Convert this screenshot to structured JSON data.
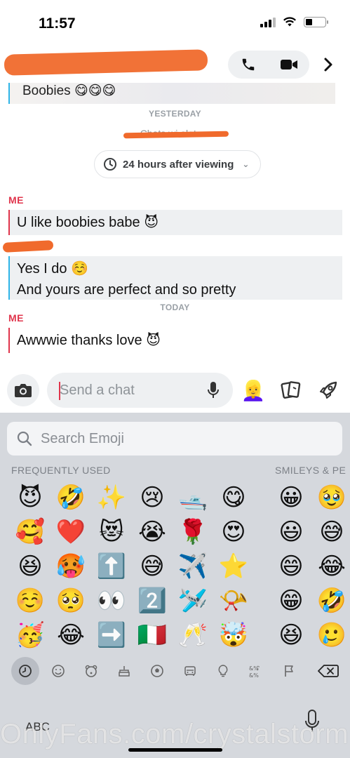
{
  "status_bar": {
    "time": "11:57",
    "battery_level": 0.35
  },
  "header": {
    "contact_name": "",
    "call_icon": "phone-icon",
    "video_icon": "video-camera-icon",
    "next_icon": "chevron-right-icon"
  },
  "messages": {
    "snap_preview_text": "Boobies 😋😋😋",
    "yesterday_label": "YESTERDAY",
    "policy_text": "Chats wi                              elete...",
    "timer_label": "24 hours after viewing",
    "me_label_1": "ME",
    "msg1": "U like boobies babe 😈",
    "msg2_line1": "Yes I do ☺️",
    "msg2_line2": "And yours are perfect and so pretty",
    "today_label": "TODAY",
    "me_label_2": "ME",
    "msg3": "Awwwie thanks love 😈"
  },
  "composer": {
    "placeholder": "Send a chat",
    "value": ""
  },
  "keyboard": {
    "search_placeholder": "Search Emoji",
    "frequently_used_label": "FREQUENTLY USED",
    "smileys_label": "SMILEYS & PE",
    "frequent_emojis": [
      "😈",
      "🤣",
      "✨",
      "😢",
      "🛥️",
      "😋",
      "🥰",
      "❤️",
      "😻",
      "😭",
      "🌹",
      "😍",
      "😆",
      "🥵",
      "⬆️",
      "😅",
      "✈️",
      "⭐",
      "☺️",
      "🥺",
      "👀",
      "2️⃣",
      "🛩️",
      "📯",
      "🥳",
      "😂",
      "➡️",
      "🇮🇹",
      "🥂",
      "🤯"
    ],
    "smiley_emojis": [
      "😀",
      "🥹",
      "😃",
      "😅",
      "😄",
      "😂",
      "😁",
      "🤣",
      "😆",
      "🥲"
    ],
    "abc_label": "ABC"
  },
  "watermark": "OnlyFans.com/crystalstorm"
}
